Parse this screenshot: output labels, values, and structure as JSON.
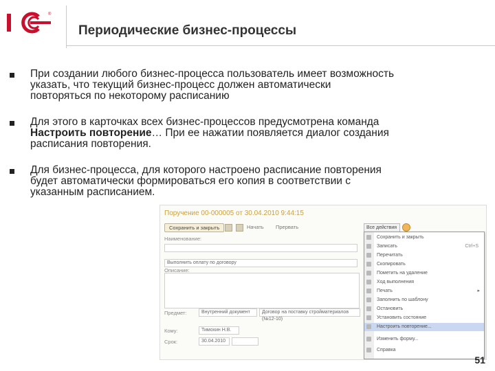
{
  "title": "Периодические бизнес-процессы",
  "logo_text": "1С",
  "bullets": [
    {
      "before": "При создании любого бизнес-процесса пользователь имеет возможность указать, что текущий бизнес-процесс должен автоматически повторяться по некоторому расписанию",
      "bold": "",
      "after": ""
    },
    {
      "before": "Для этого в карточках всех бизнес-процессов предусмотрена команда ",
      "bold": "Настроить повторение",
      "after": "… При ее нажатии появляется диалог создания расписания повторения."
    },
    {
      "before": "Для  бизнес-процесса, для которого настроено расписание повторения будет автоматически формироваться его копия в соответствии с указанным расписанием.",
      "bold": "",
      "after": ""
    }
  ],
  "page_number": "51",
  "screenshot": {
    "doc_title": "Поручение 00-000005 от 30.04.2010 9:44:15",
    "save_button": "Сохранить и закрыть",
    "toolbar_text_1": "Начать",
    "toolbar_text_2": "Прервать",
    "all_actions": "Все действия",
    "lbl_name": "Наименование:",
    "val_name": "Выполнить оплату по договору",
    "lbl_task": "Описание:",
    "lbl_subject": "Предмет:",
    "val_subject_1": "Внутренний документ",
    "val_subject_2": "Договор на поставку стройматериалов (№12-10)",
    "lbl_who": "Кому:",
    "val_who": "Тимохин Н.В.",
    "lbl_due": "Срок:",
    "val_due": "30.04.2010",
    "menu": [
      {
        "text": "Сохранить и закрыть",
        "key": ""
      },
      {
        "text": "Записать",
        "key": "Ctrl+S"
      },
      {
        "text": "Перечитать",
        "key": ""
      },
      {
        "text": "Скопировать",
        "key": ""
      },
      {
        "text": "Пометить на удаление",
        "key": ""
      },
      {
        "text": "Ход выполнения",
        "key": ""
      },
      {
        "text": "Печать",
        "key": "",
        "arrow": true
      },
      {
        "text": "Заполнить по шаблону",
        "key": ""
      },
      {
        "text": "Остановить",
        "key": ""
      },
      {
        "text": "Установить состояние",
        "key": ""
      },
      {
        "text": "Настроить повторение...",
        "key": "",
        "highlight": true
      },
      {
        "text": "Изменить форму...",
        "key": ""
      },
      {
        "text": "Справка",
        "key": ""
      }
    ]
  },
  "colors": {
    "accent": "#c8102e",
    "title": "#333333",
    "highlight": "#c9d7f0"
  }
}
